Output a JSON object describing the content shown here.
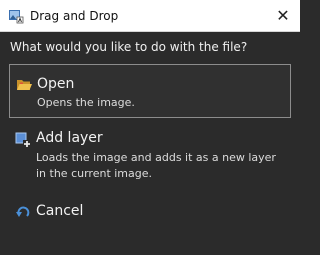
{
  "window": {
    "title": "Drag and Drop",
    "close_glyph": "✕",
    "app_icon": "image-app-icon"
  },
  "prompt": "What would you like to do with the file?",
  "options": [
    {
      "id": "open",
      "title": "Open",
      "description": "Opens the image.",
      "icon": "folder-open-icon",
      "selected": true
    },
    {
      "id": "add-layer",
      "title": "Add layer",
      "description": "Loads the image and adds it as a new layer in the current image.",
      "icon": "add-layer-icon",
      "selected": false
    },
    {
      "id": "cancel",
      "title": "Cancel",
      "icon": "undo-arrow-icon",
      "selected": false
    }
  ],
  "colors": {
    "background": "#2b2b2b",
    "titlebar": "#ffffff",
    "selection_border": "#8c8c8c",
    "accent_blue": "#4a90d9",
    "folder_yellow": "#e8b23a"
  }
}
